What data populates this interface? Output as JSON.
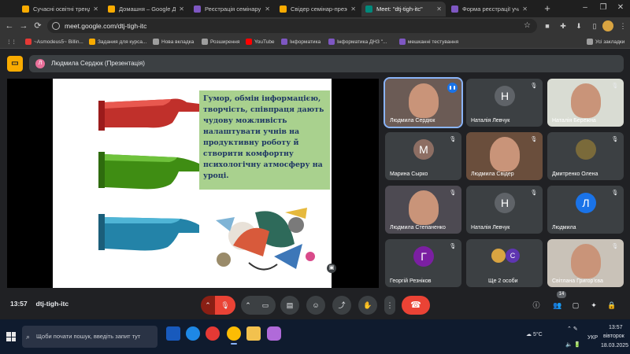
{
  "tabs": [
    {
      "title": "Сучасні освітні тренди се",
      "color": "#f9ab00",
      "active": false
    },
    {
      "title": "Домашня – Google Диск",
      "color": "#f9ab00",
      "active": false
    },
    {
      "title": "Реєстрація семінару мате",
      "color": "#7e57c2",
      "active": false
    },
    {
      "title": "Свідер семінар-презентац",
      "color": "#f9ab00",
      "active": false
    },
    {
      "title": "Meet: \"dtj-tigh-itc\"",
      "color": "#00897b",
      "active": true
    },
    {
      "title": "Форма реєстрації учасни",
      "color": "#7e57c2",
      "active": false
    }
  ],
  "tab_close": "✕",
  "address_url": "meet.google.com/dtj-tigh-itc",
  "bookmarks": [
    {
      "label": "~Asmodeus5~ Billin...",
      "color": "#e53935"
    },
    {
      "label": "Задания для курса...",
      "color": "#f9ab00"
    },
    {
      "label": "Нова вкладка",
      "color": "#9e9e9e"
    },
    {
      "label": "Розширення",
      "color": "#9e9e9e"
    },
    {
      "label": "YouTube",
      "color": "#ff0000"
    },
    {
      "label": "Інформатика",
      "color": "#7e57c2"
    },
    {
      "label": "Інформатика ДНЗ \"...",
      "color": "#7e57c2"
    },
    {
      "label": "мешканні тестування",
      "color": "#7e57c2"
    }
  ],
  "all_bookmarks": "Усі закладки",
  "presenter_bar": {
    "avatar_letter": "Л",
    "label": "Людмила Сердюк (Презентація)"
  },
  "slide": {
    "text": "Гумор, обмін інформацією, творчість, співпраця дають чудову можливість налаштувати учнів на продуктивну роботу й створити комфортну психологічну атмосферу на уроці."
  },
  "participants": [
    {
      "name": "Людмила Сердюк",
      "type": "video",
      "speaking": true
    },
    {
      "name": "Наталія Левчук",
      "type": "avatar",
      "letter": "Н",
      "avatar_color": "#5f6368"
    },
    {
      "name": "Наталія Бережна",
      "type": "video"
    },
    {
      "name": "Марина Сырко",
      "type": "avatar",
      "letter": "М",
      "avatar_color": "#8d6e63"
    },
    {
      "name": "Людмила Свідер",
      "type": "video"
    },
    {
      "name": "Дмитренко Олена",
      "type": "photo"
    },
    {
      "name": "Людмила Степаненко",
      "type": "video"
    },
    {
      "name": "Наталія Левчук",
      "type": "avatar",
      "letter": "Н",
      "avatar_color": "#5f6368"
    },
    {
      "name": "Людмила",
      "type": "avatar",
      "letter": "Л",
      "avatar_color": "#1a73e8"
    },
    {
      "name": "Георгій Резніков",
      "type": "avatar",
      "letter": "Г",
      "avatar_color": "#7b1fa2"
    },
    {
      "name": "Ще 2 особи",
      "type": "others",
      "letter": "С"
    },
    {
      "name": "Світлана Григор'єва",
      "type": "video"
    }
  ],
  "bottom": {
    "time": "13:57",
    "meeting_code": "dtj-tigh-itc",
    "participants_count": "14"
  },
  "taskbar": {
    "search_placeholder": "Щоби почати пошук, введіть запит тут",
    "weather": "5°C",
    "lang": "УКР",
    "time": "13:57",
    "day": "вівторок",
    "date": "18.03.2025"
  }
}
